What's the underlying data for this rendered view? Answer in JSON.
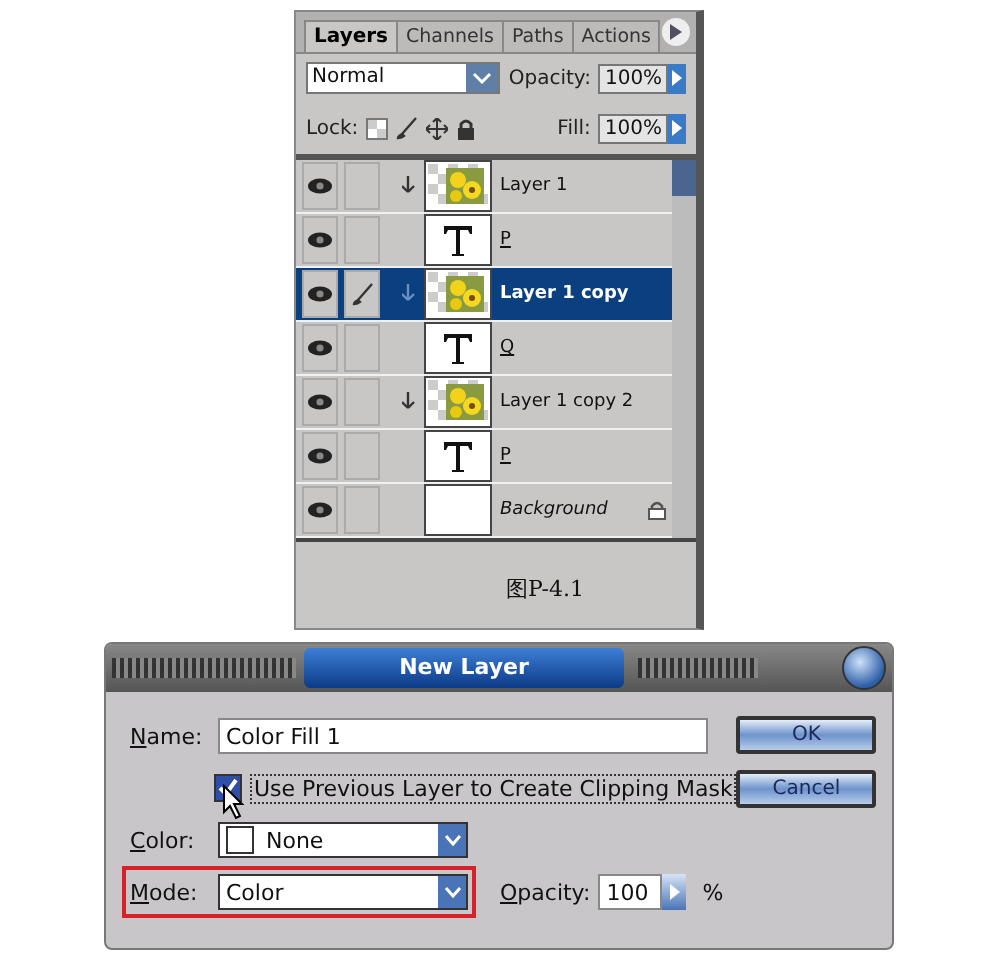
{
  "layers_panel": {
    "tabs": [
      {
        "label": "Layers",
        "selected": true
      },
      {
        "label": "Channels",
        "selected": false
      },
      {
        "label": "Paths",
        "selected": false
      },
      {
        "label": "Actions",
        "selected": false
      }
    ],
    "blend_mode": "Normal",
    "opacity_label": "Opacity:",
    "opacity": "100%",
    "lock_label": "Lock:",
    "fill_label": "Fill:",
    "fill": "100%",
    "layers": [
      {
        "name": "Layer 1",
        "kind": "image",
        "selected": false,
        "visible": true,
        "clipped": true,
        "locked": false
      },
      {
        "name": "P",
        "kind": "text",
        "selected": false,
        "visible": true,
        "clipped": false,
        "locked": false
      },
      {
        "name": "Layer 1 copy",
        "kind": "image",
        "selected": true,
        "visible": true,
        "clipped": true,
        "locked": false
      },
      {
        "name": "Q",
        "kind": "text",
        "selected": false,
        "visible": true,
        "clipped": false,
        "locked": false
      },
      {
        "name": "Layer 1 copy 2",
        "kind": "image",
        "selected": false,
        "visible": true,
        "clipped": true,
        "locked": false
      },
      {
        "name": "P",
        "kind": "text",
        "selected": false,
        "visible": true,
        "clipped": false,
        "locked": false
      },
      {
        "name": "Background",
        "kind": "blank",
        "selected": false,
        "visible": true,
        "clipped": false,
        "locked": true
      }
    ],
    "figure_label": "图P-4.1"
  },
  "dialog": {
    "title": "New Layer",
    "name_label": "Name:",
    "name_value": "Color Fill 1",
    "clipping": {
      "label": "Use Previous Layer to Create Clipping Mask",
      "checked": true
    },
    "color_label": "Color:",
    "color_value": "None",
    "mode_label": "Mode:",
    "mode_value": "Color",
    "mode_highlighted": true,
    "opacity_label": "Opacity:",
    "opacity_value": "100",
    "opacity_unit": "%",
    "buttons": [
      "OK",
      "Cancel"
    ]
  }
}
